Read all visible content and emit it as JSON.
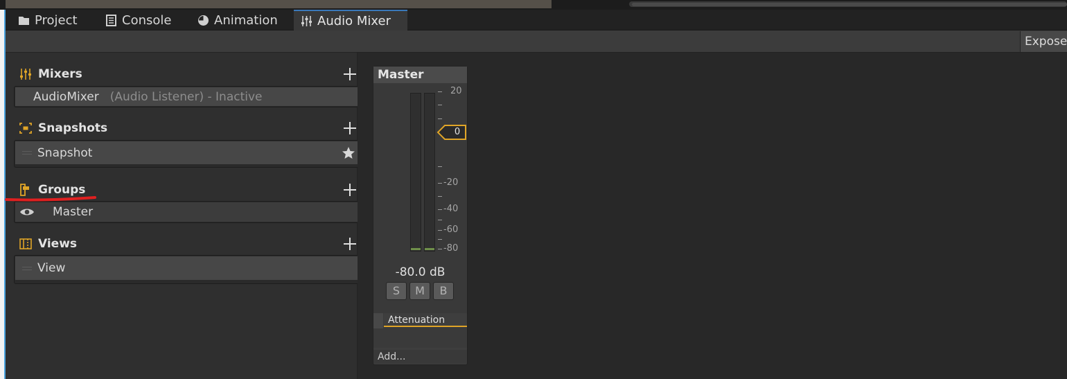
{
  "tabs": [
    {
      "label": "Project",
      "icon": "folder-icon"
    },
    {
      "label": "Console",
      "icon": "console-icon"
    },
    {
      "label": "Animation",
      "icon": "animation-clock-icon"
    },
    {
      "label": "Audio Mixer",
      "icon": "audio-mixer-icon",
      "active": true
    }
  ],
  "toolbar": {
    "exposed_label": "Exposed"
  },
  "sections": {
    "mixers": {
      "title": "Mixers",
      "item_name": "AudioMixer",
      "item_status": "(Audio Listener) - Inactive"
    },
    "snapshots": {
      "title": "Snapshots",
      "item": "Snapshot"
    },
    "groups": {
      "title": "Groups",
      "item": "Master"
    },
    "views": {
      "title": "Views",
      "item": "View"
    }
  },
  "channel_strip": {
    "name": "Master",
    "scale": [
      "20",
      "0",
      "-20",
      "-40",
      "-60",
      "-80"
    ],
    "fader_value": "0",
    "db_readout": "-80.0 dB",
    "solo_label": "S",
    "mute_label": "M",
    "bypass_label": "B",
    "effects": [
      "Attenuation"
    ],
    "add_label": "Add..."
  },
  "colors": {
    "accent_yellow": "#e0a527",
    "tab_active_highlight": "#3a79bb",
    "annotation_red": "#e02020",
    "meter_green": "#6f8f4a"
  }
}
